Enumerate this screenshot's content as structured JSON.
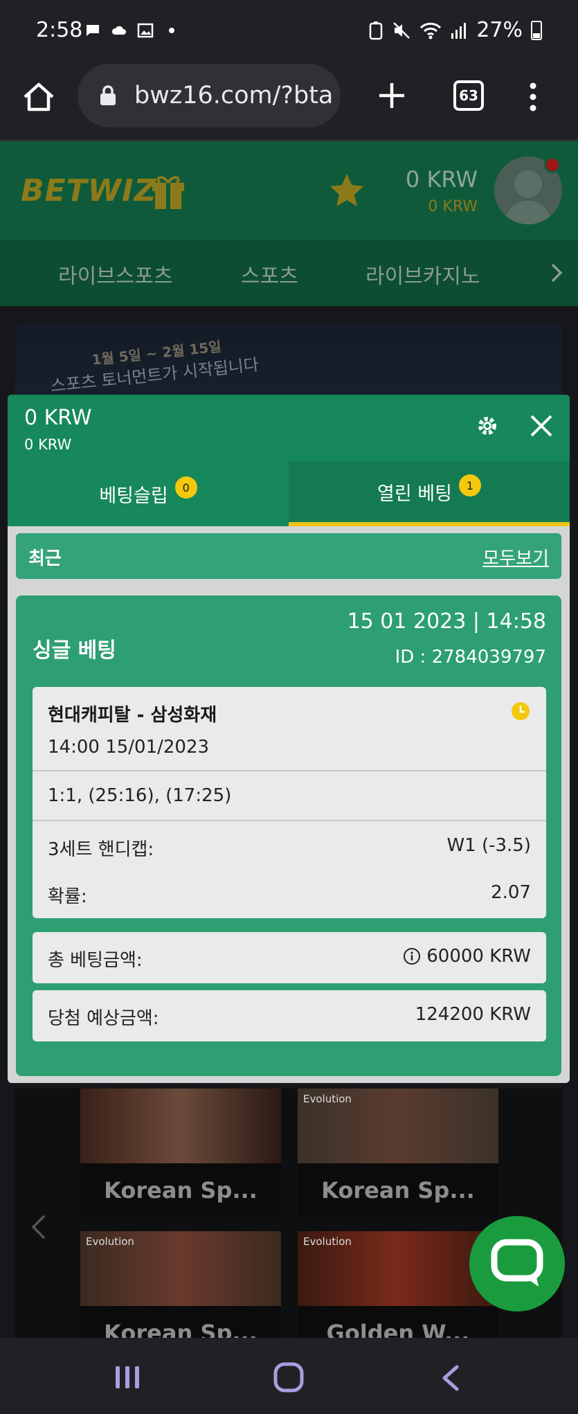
{
  "statusbar": {
    "time": "2:58",
    "battery": "27%"
  },
  "browser": {
    "url": "bwz16.com/?bta",
    "tab_count": "63"
  },
  "header": {
    "logo_bet": "BET",
    "logo_wiz": "WIZ",
    "balance": "0 KRW",
    "balance_sub": "0 KRW"
  },
  "nav": {
    "items": [
      "라이브스포츠",
      "스포츠",
      "라이브카지노"
    ]
  },
  "banner": {
    "line1": "1월 5일 ~ 2월 15일",
    "line2": "스포츠 토너먼트가 시작됩니다"
  },
  "slip": {
    "balance": "0 KRW",
    "balance_sub": "0 KRW",
    "tabs": [
      {
        "label": "베팅슬립",
        "badge": "0"
      },
      {
        "label": "열린 베팅",
        "badge": "1"
      }
    ],
    "recent_label": "최근",
    "view_all": "모두보기",
    "bet": {
      "type": "싱글 베팅",
      "datetime": "15 01 2023 | 14:58",
      "id": "ID :  2784039797",
      "event_name": "현대캐피탈 - 삼성화재",
      "event_time": "14:00   15/01/2023",
      "score": "1:1, (25:16), (17:25)",
      "market_label": "3세트 핸디캡:",
      "market_value": "W1 (-3.5)",
      "odds_label": "확률:",
      "odds_value": "2.07",
      "total_label": "총 베팅금액:",
      "total_value": "60000 KRW",
      "win_label": "당첨 예상금액:",
      "win_value": "124200 KRW"
    }
  },
  "games": [
    {
      "label": "Korean Sp...",
      "provider": ""
    },
    {
      "label": "Korean Sp...",
      "provider": "Evolution"
    },
    {
      "label": "Korean Sp...",
      "provider": "Evolution"
    },
    {
      "label": "Golden W...",
      "provider": "Evolution"
    }
  ],
  "colors": {
    "slip_green": "#16885b",
    "card_green": "#2d9f73",
    "accent_yellow": "#f4c80c",
    "chat_green": "#1a9c3e"
  }
}
